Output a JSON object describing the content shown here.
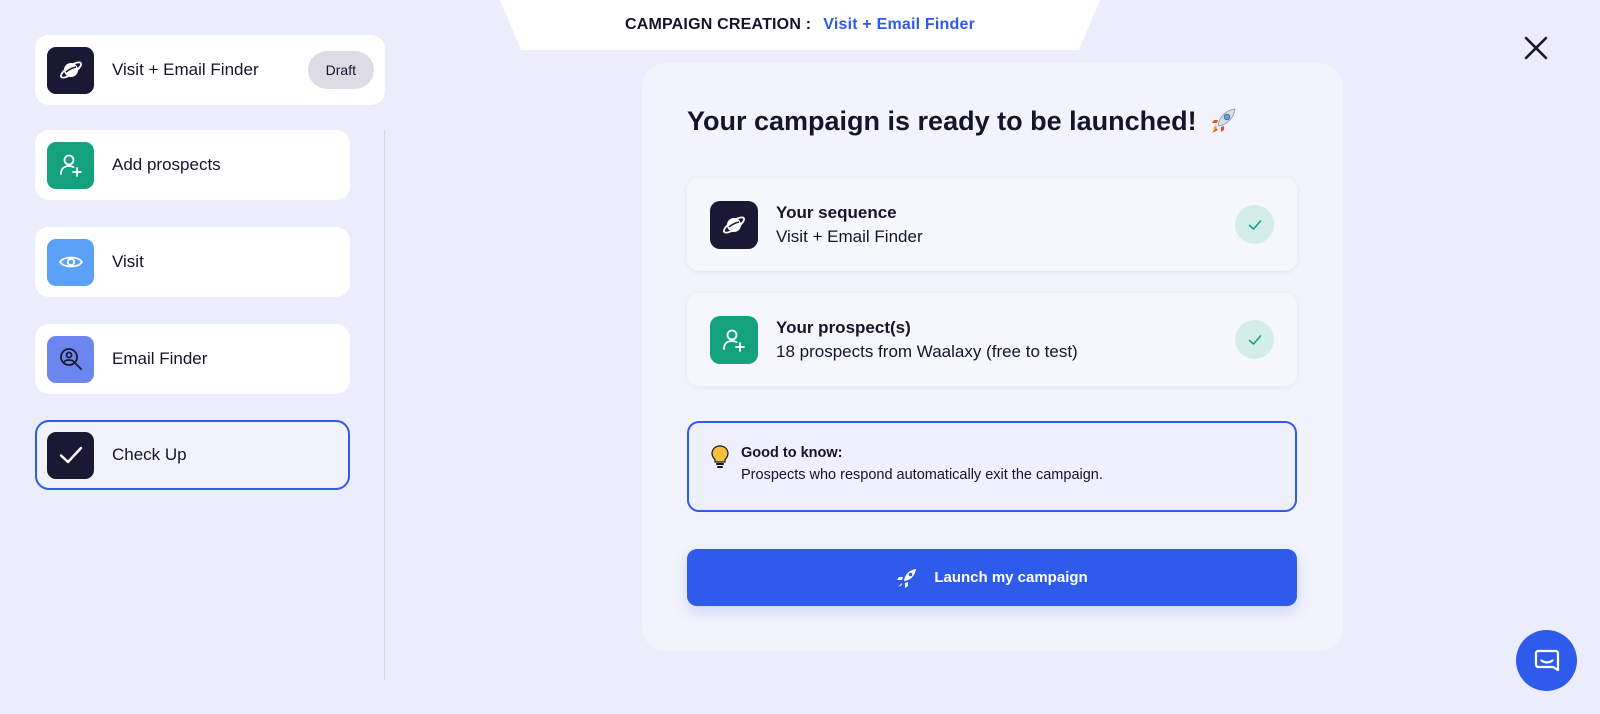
{
  "header": {
    "label": "CAMPAIGN CREATION :",
    "campaign_name": "Visit + Email Finder"
  },
  "sidebar": {
    "campaign": {
      "name": "Visit + Email Finder",
      "badge": "Draft",
      "icon": "planet-icon",
      "icon_bg": "#1a1833"
    },
    "steps": [
      {
        "label": "Add prospects",
        "icon": "add-user-icon",
        "icon_bg": "#14a17e"
      },
      {
        "label": "Visit",
        "icon": "eye-icon",
        "icon_bg": "#5aa1f7"
      },
      {
        "label": "Email Finder",
        "icon": "user-search-icon",
        "icon_bg": "#6b86ef"
      },
      {
        "label": "Check Up",
        "icon": "check-icon",
        "icon_bg": "#1a1833",
        "active": true
      }
    ]
  },
  "main": {
    "title": "Your campaign is ready to be launched!",
    "title_emoji": "rocket-emoji",
    "cards": [
      {
        "title": "Your sequence",
        "subtitle": "Visit + Email Finder",
        "icon": "planet-icon",
        "status": "check-icon"
      },
      {
        "title": "Your prospect(s)",
        "subtitle": "18 prospects from Waalaxy (free to test)",
        "icon": "add-user-icon",
        "status": "check-icon"
      }
    ],
    "info": {
      "title": "Good to know:",
      "text": "Prospects who respond automatically exit the campaign.",
      "icon": "lightbulb-icon"
    },
    "launch_button": "Launch my campaign"
  },
  "colors": {
    "accent": "#2f5bea",
    "background": "#ebedfd",
    "dark": "#1a1833",
    "green": "#14a17e"
  },
  "chat": {
    "icon": "chat-icon"
  },
  "close": {
    "icon": "close-icon"
  }
}
